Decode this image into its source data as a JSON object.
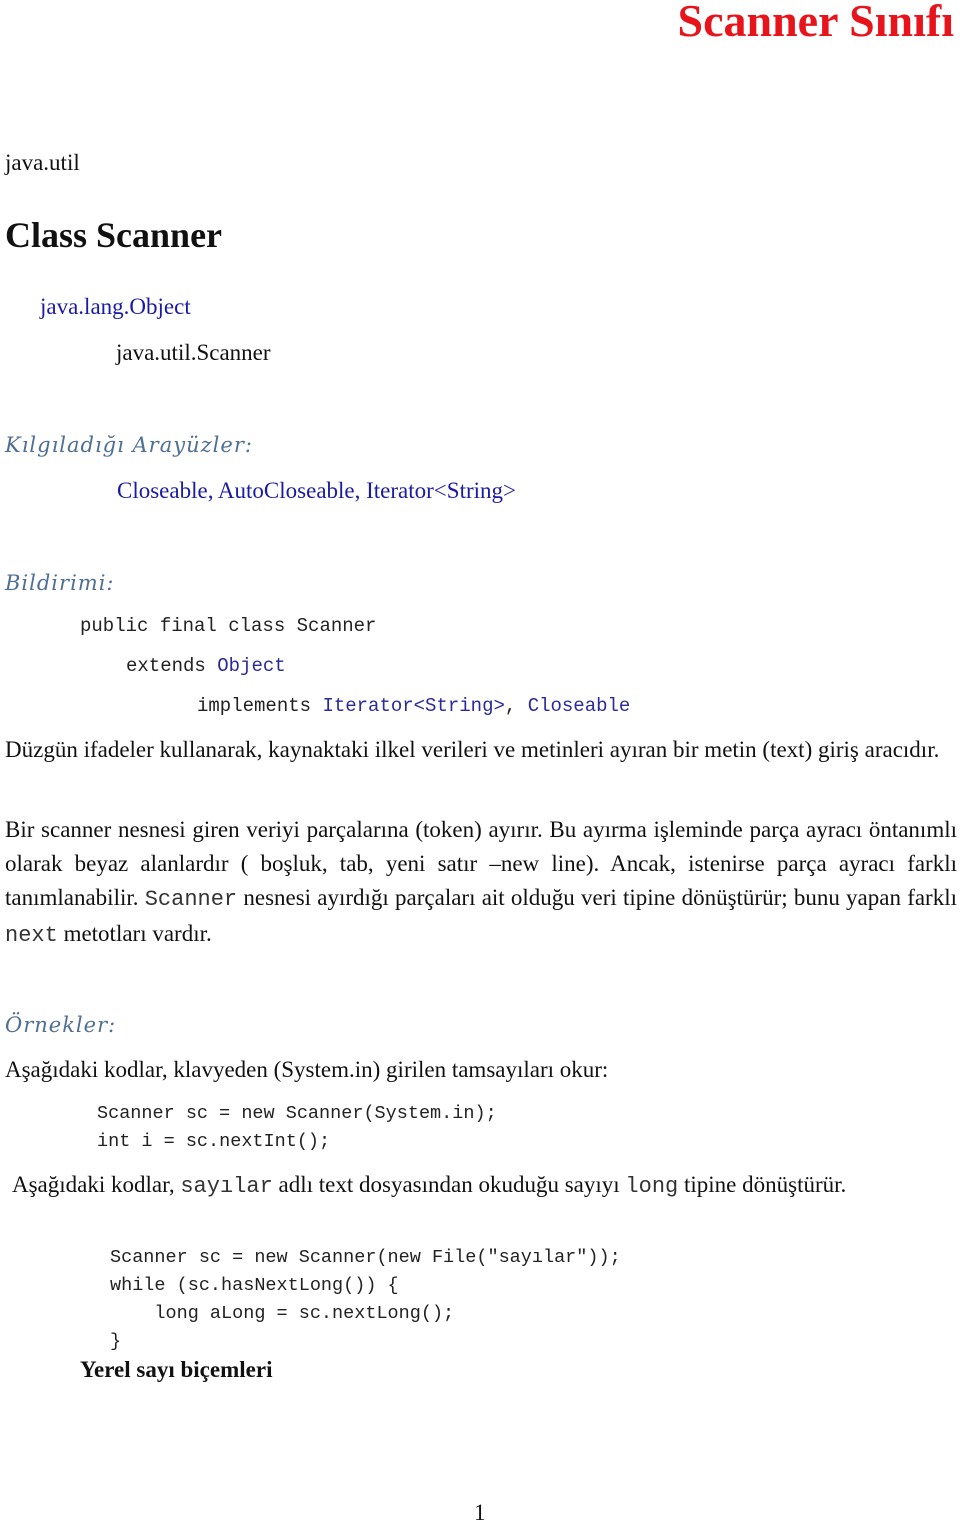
{
  "page_title": "Scanner Sınıfı",
  "package": "java.util",
  "class_heading": "Class Scanner",
  "hierarchy": {
    "parent": "java.lang.Object",
    "child": "java.util.Scanner"
  },
  "implemented_interfaces": {
    "heading": "Kılgıladığı Arayüzler:",
    "list": "Closeable, AutoCloseable, Iterator<String>"
  },
  "declaration": {
    "heading": "Bildirimi:",
    "line1": "public final class Scanner",
    "line2_kw": "extends",
    "line2_link": "Object",
    "line3_kw": "implements",
    "line3_link1": "Iterator<String>",
    "line3_sep": ",",
    "line3_link2": "Closeable"
  },
  "paragraphs": {
    "p1": "Düzgün ifadeler kullanarak, kaynaktaki ilkel verileri ve metinleri ayıran bir metin (text) giriş aracıdır.",
    "p2_a": "Bir scanner nesnesi giren veriyi parçalarına  (token) ayırır. Bu ayırma işleminde parça ayracı öntanımlı olarak beyaz  alanlardır ( boşluk, tab, yeni satır –new line). Ancak, istenirse parça ayracı farklı tanımlanabilir. ",
    "p2_code1": "Scanner",
    "p2_b": " nesnesi ayırdığı parçaları ait olduğu veri tipine dönüştürür; bunu yapan farklı ",
    "p2_code2": "next",
    "p2_c": " metotları vardır."
  },
  "examples": {
    "heading": "Örnekler:",
    "example1_intro": "Aşağıdaki kodlar, klavyeden (System.in) girilen tamsayıları okur:",
    "example1_code": [
      "Scanner sc = new Scanner(System.in);",
      "int i = sc.nextInt();"
    ],
    "example2_intro_a": "Aşağıdaki kodlar, ",
    "example2_intro_code1": "sayılar",
    "example2_intro_b": " adlı text dosyasından okuduğu  sayıyı ",
    "example2_intro_code2": "long",
    "example2_intro_c": " tipine dönüştürür.",
    "example2_code": [
      "Scanner sc = new Scanner(new File(\"sayılar\"));",
      "while (sc.hasNextLong()) {",
      "    long aLong = sc.nextLong();",
      "}"
    ]
  },
  "subheading": "Yerel sayı biçemleri",
  "page_number": "1",
  "colors": {
    "title": "#e8141b",
    "link": "#1a1aa6",
    "heading": "#4f6f93"
  }
}
